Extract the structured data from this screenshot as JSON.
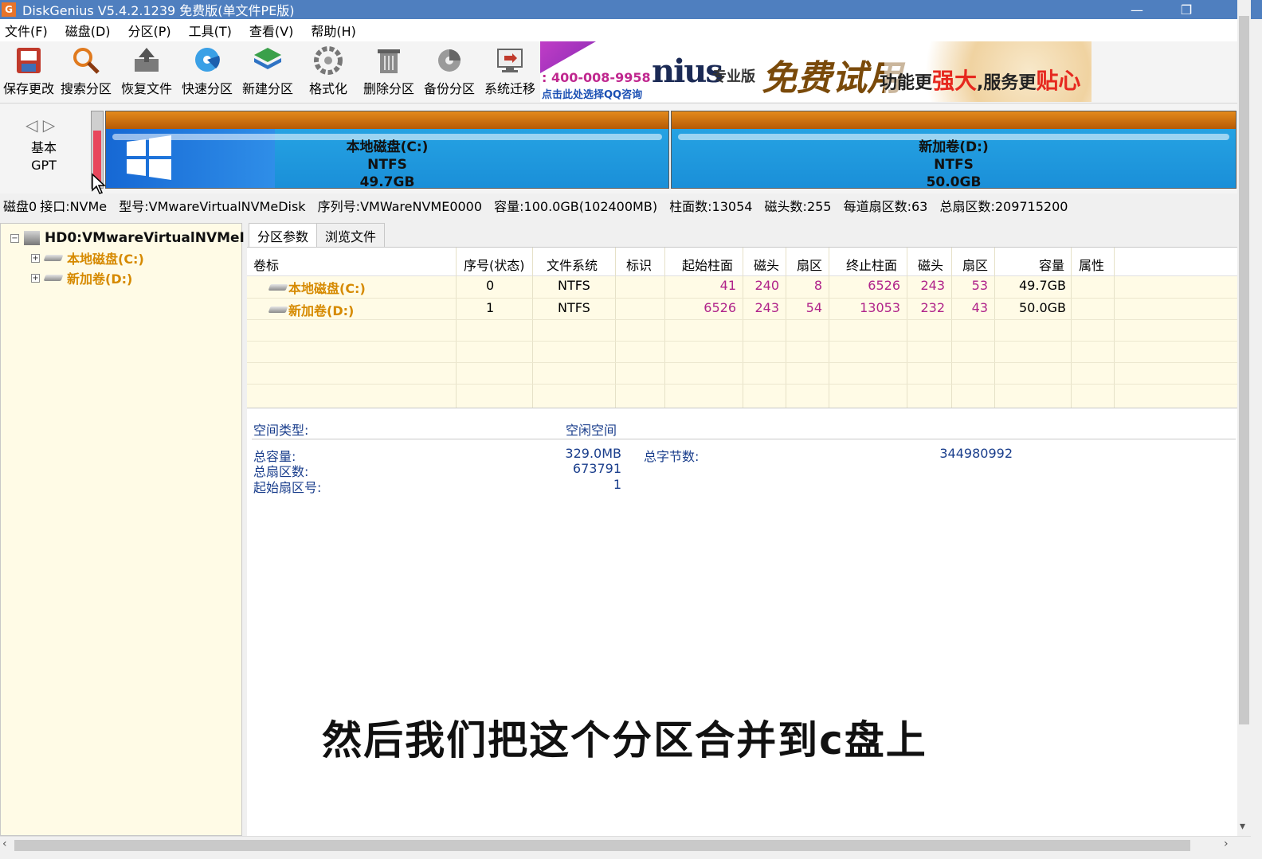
{
  "window": {
    "title": "DiskGenius V5.4.2.1239 免费版(单文件PE版)",
    "icon_name": "diskgenius-app-icon",
    "icon_glyph": "G",
    "controls": {
      "minimize": "—",
      "restore": "❐",
      "close": "✕"
    }
  },
  "menu": [
    "文件(F)",
    "磁盘(D)",
    "分区(P)",
    "工具(T)",
    "查看(V)",
    "帮助(H)"
  ],
  "toolbar": [
    {
      "label": "保存更改",
      "icon": "save-icon"
    },
    {
      "label": "搜索分区",
      "icon": "search-partition-icon"
    },
    {
      "label": "恢复文件",
      "icon": "recover-file-icon"
    },
    {
      "label": "快速分区",
      "icon": "quick-partition-icon"
    },
    {
      "label": "新建分区",
      "icon": "new-partition-icon"
    },
    {
      "label": "格式化",
      "icon": "format-icon"
    },
    {
      "label": "删除分区",
      "icon": "delete-partition-icon"
    },
    {
      "label": "备份分区",
      "icon": "backup-partition-icon"
    },
    {
      "label": "系统迁移",
      "icon": "system-migrate-icon"
    }
  ],
  "ad": {
    "phone": "400-008-9958",
    "phone_prefix": ":",
    "qq": "点击此处选择QQ咨询",
    "logo": "nius",
    "edition": "专业版",
    "free_trial": "免费试用",
    "slogan_a": "功能更",
    "slogan_b": "强大",
    "slogan_c": ",服务更",
    "slogan_d": "贴心"
  },
  "diskmap": {
    "nav_left": "◁",
    "nav_right": "▷",
    "type_line1": "基本",
    "type_line2": "GPT",
    "partitions": [
      {
        "name": "本地磁盘(C:)",
        "fs": "NTFS",
        "size": "49.7GB"
      },
      {
        "name": "新加卷(D:)",
        "fs": "NTFS",
        "size": "50.0GB"
      }
    ]
  },
  "disk_info": {
    "disk": "磁盘0",
    "interface": "接口:NVMe",
    "model": "型号:VMwareVirtualNVMeDisk",
    "serial": "序列号:VMWareNVME0000",
    "capacity": "容量:100.0GB(102400MB)",
    "cylinders": "柱面数:13054",
    "heads": "磁头数:255",
    "sectors_per_track": "每道扇区数:63",
    "total_sectors": "总扇区数:209715200"
  },
  "tree": {
    "root": "HD0:VMwareVirtualNVMeI",
    "children": [
      "本地磁盘(C:)",
      "新加卷(D:)"
    ]
  },
  "tabs": [
    "分区参数",
    "浏览文件"
  ],
  "table": {
    "headers": [
      "卷标",
      "序号(状态)",
      "文件系统",
      "标识",
      "起始柱面",
      "磁头",
      "扇区",
      "终止柱面",
      "磁头",
      "扇区",
      "容量",
      "属性"
    ],
    "rows": [
      {
        "label": "本地磁盘(C:)",
        "index": "0",
        "fs": "NTFS",
        "id": "",
        "start_cyl": "41",
        "start_head": "240",
        "start_sec": "8",
        "end_cyl": "6526",
        "end_head": "243",
        "end_sec": "53",
        "size": "49.7GB",
        "attr": ""
      },
      {
        "label": "新加卷(D:)",
        "index": "1",
        "fs": "NTFS",
        "id": "",
        "start_cyl": "6526",
        "start_head": "243",
        "start_sec": "54",
        "end_cyl": "13053",
        "end_head": "232",
        "end_sec": "43",
        "size": "50.0GB",
        "attr": ""
      }
    ]
  },
  "details": {
    "space_type_label": "空间类型:",
    "space_type_value": "空闲空间",
    "total_cap_label": "总容量:",
    "total_cap_value": "329.0MB",
    "total_bytes_label": "总字节数:",
    "total_bytes_value": "344980992",
    "total_sectors_label": "总扇区数:",
    "total_sectors_value": "673791",
    "start_sector_label": "起始扇区号:",
    "start_sector_value": "1"
  },
  "subtitle": "然后我们把这个分区合并到c盘上",
  "colors": {
    "titlebar": "#4f7fbf",
    "partition_name": "#d68a00",
    "number": "#b0238a",
    "detail_text": "#1a3e8c",
    "partition_top": "#c96c10",
    "partition_body": "#1f9be0"
  }
}
